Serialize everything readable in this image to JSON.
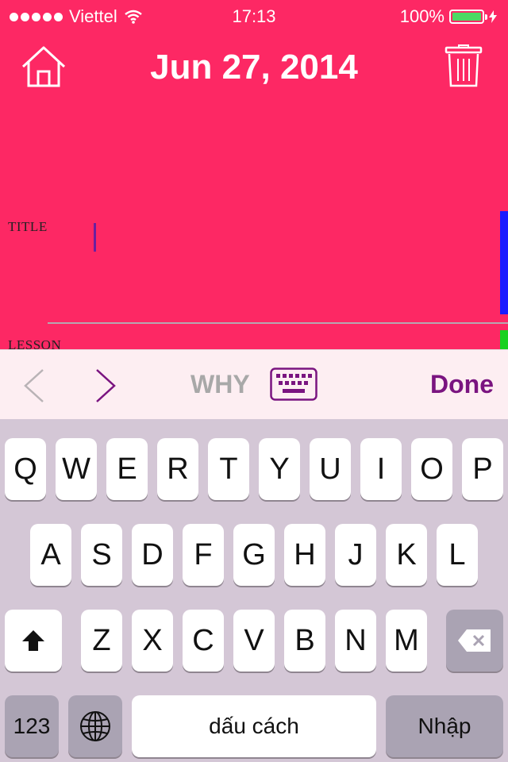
{
  "status_bar": {
    "carrier": "Viettel",
    "time": "17:13",
    "battery": "100%"
  },
  "header": {
    "date_title": "Jun 27, 2014"
  },
  "form": {
    "title_label": "TITLE",
    "lesson_label": "LESSON",
    "accent_colors": [
      "#1c1bff",
      "#19d11f"
    ]
  },
  "toolbar": {
    "why_label": "WHY",
    "done_label": "Done"
  },
  "keyboard": {
    "row1": [
      "Q",
      "W",
      "E",
      "R",
      "T",
      "Y",
      "U",
      "I",
      "O",
      "P"
    ],
    "row2": [
      "A",
      "S",
      "D",
      "F",
      "G",
      "H",
      "J",
      "K",
      "L"
    ],
    "row3": [
      "Z",
      "X",
      "C",
      "V",
      "B",
      "N",
      "M"
    ],
    "numbers_label": "123",
    "space_label": "dấu cách",
    "return_label": "Nhập"
  },
  "colors": {
    "background": "#fd2864",
    "accent": "#7a1480"
  }
}
